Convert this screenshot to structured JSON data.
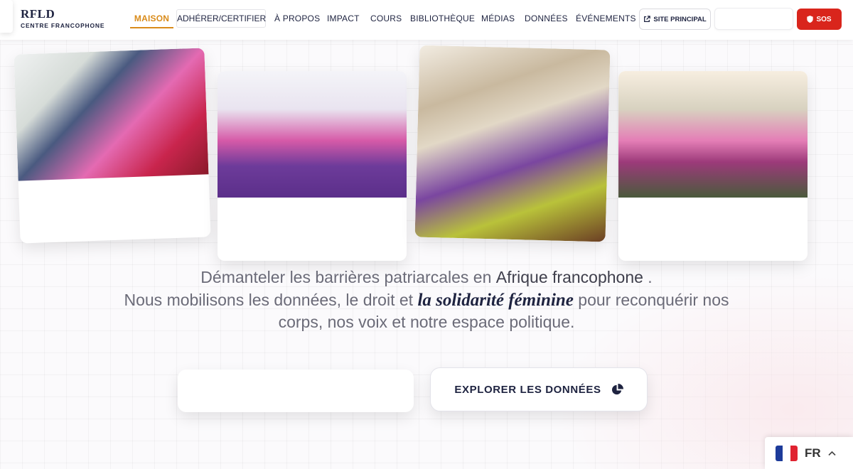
{
  "header": {
    "logo_title": "RFLD",
    "logo_subtitle": "CENTRE FRANCOPHONE",
    "nav": {
      "maison": "MAISON",
      "adherer": "ADHÉRER/CERTIFIER",
      "apropos": "À PROPOS",
      "impact": "IMPACT",
      "cours": "COURS",
      "bibliotheque": "BIBLIOTHÈQUE",
      "medias": "MÉDIAS",
      "donnees": "DONNÉES",
      "evenements": "ÉVÉNEMENTS"
    },
    "site_principal": "SITE PRINCIPAL",
    "sos": "SOS",
    "active_color": "#d98b1a",
    "sos_color": "#d9251c"
  },
  "hero": {
    "line1_a": "Démanteler les barrières patriarcales en ",
    "line1_b": "Afrique francophone",
    "line1_c": " .",
    "line2_a": "Nous mobilisons les données, le droit et ",
    "line2_b": "la solidarité féminine",
    "line2_c": " pour reconquérir nos",
    "line3": "corps, nos voix et notre espace politique."
  },
  "cta": {
    "explore": "EXPLORER LES DONNÉES",
    "explore_icon": "pie-chart-icon"
  },
  "language": {
    "code": "FR",
    "flag": "france-flag-icon"
  }
}
